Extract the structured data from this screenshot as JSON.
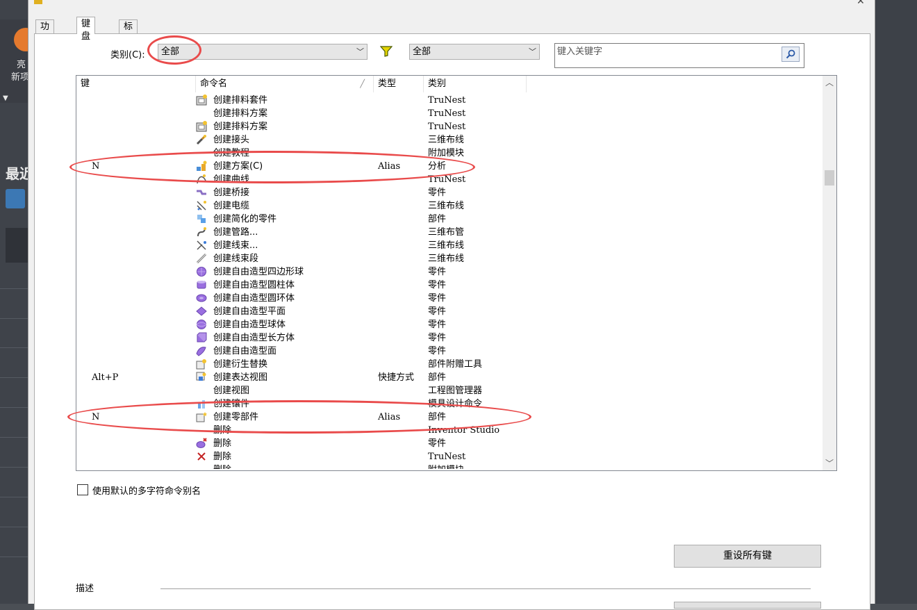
{
  "background_app": {
    "label_1": "亮",
    "label_2": "新项",
    "label_3": "最近"
  },
  "tabs": [
    {
      "label": "功能区"
    },
    {
      "label": "键盘"
    },
    {
      "label": "标记菜单"
    }
  ],
  "filter": {
    "category_label": "类别(C)",
    "category_value": "全部",
    "funnel_icon": "funnel-icon",
    "type_value": "全部",
    "search_placeholder": "键入关键字",
    "search_icon": "search-icon"
  },
  "list": {
    "columns": [
      "键",
      "命令名",
      "类型",
      "类别"
    ],
    "rows": [
      {
        "key": "",
        "icon": "nest-icon",
        "name": "创建排料套件",
        "type": "",
        "category": "TruNest"
      },
      {
        "key": "",
        "icon": "",
        "name": "创建排料方案",
        "type": "",
        "category": "TruNest"
      },
      {
        "key": "",
        "icon": "nest-icon",
        "name": "创建排料方案",
        "type": "",
        "category": "TruNest"
      },
      {
        "key": "",
        "icon": "connector-icon",
        "name": "创建接头",
        "type": "",
        "category": "三维布线"
      },
      {
        "key": "",
        "icon": "",
        "name": "创建教程",
        "type": "",
        "category": "附加模块"
      },
      {
        "key": "N",
        "icon": "scheme-icon",
        "name": "创建方案(C)",
        "type": "Alias",
        "category": "分析"
      },
      {
        "key": "",
        "icon": "curve-icon",
        "name": "创建曲线",
        "type": "",
        "category": "TruNest"
      },
      {
        "key": "",
        "icon": "bridge-icon",
        "name": "创建桥接",
        "type": "",
        "category": "零件"
      },
      {
        "key": "",
        "icon": "cable-icon",
        "name": "创建电缆",
        "type": "",
        "category": "三维布线"
      },
      {
        "key": "",
        "icon": "simplify-icon",
        "name": "创建简化的零件",
        "type": "",
        "category": "部件"
      },
      {
        "key": "",
        "icon": "route-icon",
        "name": "创建管路...",
        "type": "",
        "category": "三维布管"
      },
      {
        "key": "",
        "icon": "harness-icon",
        "name": "创建线束...",
        "type": "",
        "category": "三维布线"
      },
      {
        "key": "",
        "icon": "segment-icon",
        "name": "创建线束段",
        "type": "",
        "category": "三维布线"
      },
      {
        "key": "",
        "icon": "freeform-icon",
        "name": "创建自由造型四边形球",
        "type": "",
        "category": "零件"
      },
      {
        "key": "",
        "icon": "freeform-cylinder-icon",
        "name": "创建自由造型圆柱体",
        "type": "",
        "category": "零件"
      },
      {
        "key": "",
        "icon": "freeform-torus-icon",
        "name": "创建自由造型圆环体",
        "type": "",
        "category": "零件"
      },
      {
        "key": "",
        "icon": "freeform-plane-icon",
        "name": "创建自由造型平面",
        "type": "",
        "category": "零件"
      },
      {
        "key": "",
        "icon": "freeform-sphere-icon",
        "name": "创建自由造型球体",
        "type": "",
        "category": "零件"
      },
      {
        "key": "",
        "icon": "freeform-box-icon",
        "name": "创建自由造型长方体",
        "type": "",
        "category": "零件"
      },
      {
        "key": "",
        "icon": "freeform-face-icon",
        "name": "创建自由造型面",
        "type": "",
        "category": "零件"
      },
      {
        "key": "",
        "icon": "substitute-icon",
        "name": "创建衍生替换",
        "type": "",
        "category": "部件附赠工具"
      },
      {
        "key": "Alt+P",
        "icon": "presentation-icon",
        "name": "创建表达视图",
        "type": "快捷方式",
        "category": "部件"
      },
      {
        "key": "",
        "icon": "",
        "name": "创建视图",
        "type": "",
        "category": "工程图管理器"
      },
      {
        "key": "",
        "icon": "insert-icon",
        "name": "创建镶件",
        "type": "",
        "category": "模具设计命令"
      },
      {
        "key": "N",
        "icon": "new-part-icon",
        "name": "创建零部件",
        "type": "Alias",
        "category": "部件"
      },
      {
        "key": "",
        "icon": "",
        "name": "删除",
        "type": "",
        "category": "Inventor Studio"
      },
      {
        "key": "",
        "icon": "delete-part-icon",
        "name": "删除",
        "type": "",
        "category": "零件"
      },
      {
        "key": "",
        "icon": "delete-x-icon",
        "name": "删除",
        "type": "",
        "category": "TruNest"
      },
      {
        "key": "",
        "icon": "",
        "name": "删除",
        "type": "",
        "category": "附加模块"
      }
    ]
  },
  "options": {
    "use_default_alias_label": "使用默认的多字符命令别名"
  },
  "buttons": {
    "reset_all_keys": "重设所有键"
  },
  "description": {
    "label": "描述"
  },
  "colors": {
    "annotation": "#e94b4b",
    "freeform": "#8b5fd6"
  }
}
